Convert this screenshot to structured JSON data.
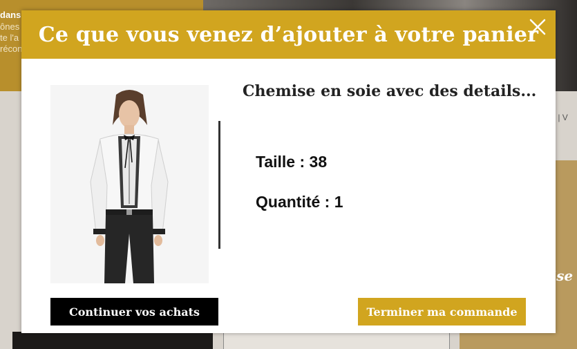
{
  "background": {
    "banner_lines": [
      "dans",
      "ônes",
      "te l'a",
      "récon"
    ],
    "breadcrumb": "its | V",
    "promo_word": "uise"
  },
  "modal": {
    "title": "Ce que vous venez d’ajouter à votre panier",
    "close_icon": "close-icon",
    "product": {
      "name": "Chemise en soie avec des details...",
      "size_label": "Taille : 38",
      "quantity_label": "Quantité : 1"
    },
    "buttons": {
      "continue_label": "Continuer vos achats",
      "checkout_label": "Terminer ma commande"
    }
  },
  "colors": {
    "accent": "#d1a51f",
    "dark": "#000000"
  }
}
